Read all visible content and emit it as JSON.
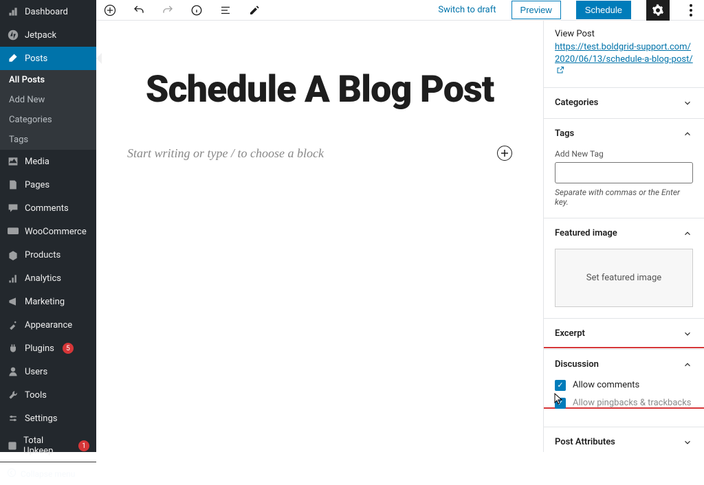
{
  "admin": {
    "items": [
      {
        "label": "Dashboard",
        "icon": "dashboard"
      },
      {
        "label": "Jetpack",
        "icon": "jetpack"
      },
      {
        "label": "Posts",
        "icon": "posts",
        "current": true,
        "sub": [
          "All Posts",
          "Add New",
          "Categories",
          "Tags"
        ]
      },
      {
        "label": "Media",
        "icon": "media"
      },
      {
        "label": "Pages",
        "icon": "pages"
      },
      {
        "label": "Comments",
        "icon": "comments"
      },
      {
        "label": "WooCommerce",
        "icon": "woo"
      },
      {
        "label": "Products",
        "icon": "products"
      },
      {
        "label": "Analytics",
        "icon": "analytics"
      },
      {
        "label": "Marketing",
        "icon": "marketing"
      },
      {
        "label": "Appearance",
        "icon": "appearance"
      },
      {
        "label": "Plugins",
        "icon": "plugins",
        "badge": "5"
      },
      {
        "label": "Users",
        "icon": "users"
      },
      {
        "label": "Tools",
        "icon": "tools"
      },
      {
        "label": "Settings",
        "icon": "settings"
      },
      {
        "label": "Total Upkeep",
        "icon": "upkeep",
        "badge": "1"
      }
    ],
    "collapse": "Collapse menu"
  },
  "toolbar": {
    "switch_draft": "Switch to draft",
    "preview": "Preview",
    "schedule": "Schedule"
  },
  "editor": {
    "title": "Schedule A Blog Post",
    "placeholder": "Start writing or type / to choose a block"
  },
  "panel": {
    "view_post": "View Post",
    "permalink": "https://test.boldgrid-support.com/2020/06/13/schedule-a-blog-post/",
    "categories": {
      "title": "Categories"
    },
    "tags": {
      "title": "Tags",
      "add_label": "Add New Tag",
      "helper": "Separate with commas or the Enter key."
    },
    "featured": {
      "title": "Featured image",
      "button": "Set featured image"
    },
    "excerpt": {
      "title": "Excerpt"
    },
    "discussion": {
      "title": "Discussion",
      "allow_comments": "Allow comments",
      "allow_pingbacks": "Allow pingbacks & trackbacks"
    },
    "attributes": {
      "title": "Post Attributes"
    }
  }
}
